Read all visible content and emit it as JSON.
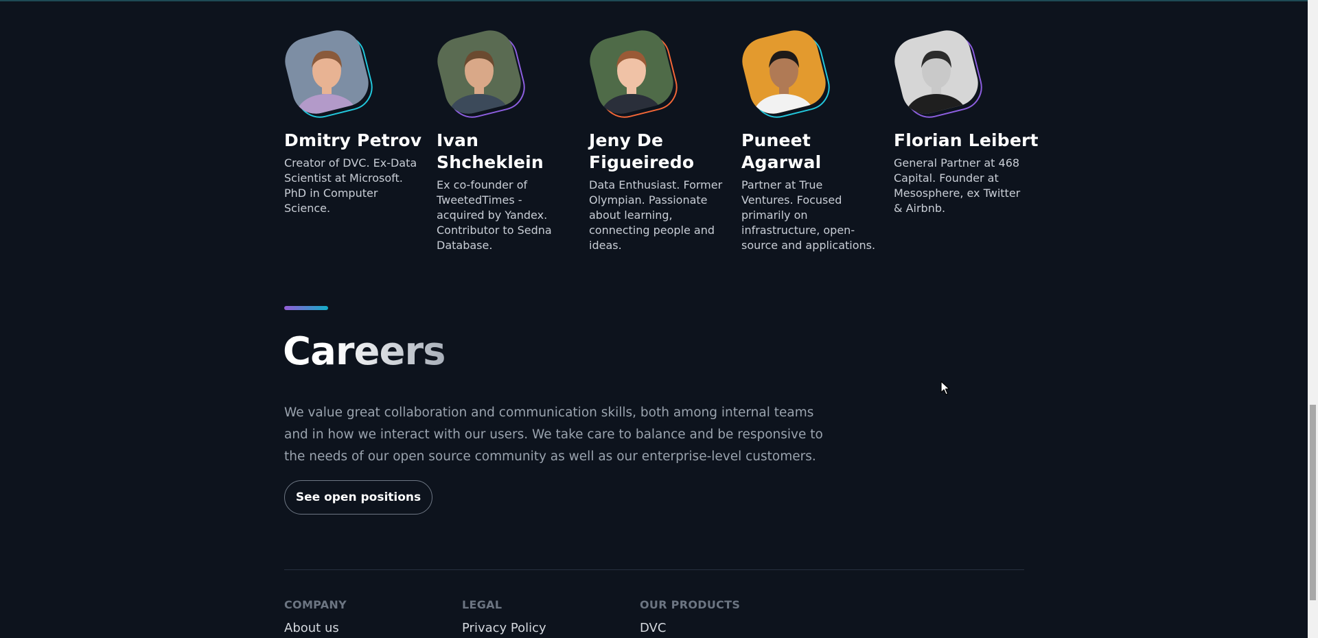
{
  "team": [
    {
      "name": "Dmitry Petrov",
      "bio": "Creator of DVC. Ex-Data Scientist at Microsoft. PhD in Computer Science.",
      "ring_color": "#22c7dc",
      "photo_bg": "#7d8ea4",
      "skin": "#e8b393",
      "hair": "#8a5a3b",
      "shirt": "#b39ac9"
    },
    {
      "name": "Ivan Shcheklein",
      "bio": "Ex co-founder of TweetedTimes - acquired by Yandex. Contributor to Sedna Database.",
      "ring_color": "#8d5fe0",
      "photo_bg": "#5a6b52",
      "skin": "#d9a888",
      "hair": "#6b4a30",
      "shirt": "#3c4a5a"
    },
    {
      "name": "Jeny De Figueiredo",
      "bio": "Data Enthusiast. Former Olympian. Passionate about learning, connecting people and ideas.",
      "ring_color": "#f46737",
      "photo_bg": "#4f6b48",
      "skin": "#f0c2a6",
      "hair": "#9a5a36",
      "shirt": "#2a2f3a"
    },
    {
      "name": "Puneet Agarwal",
      "bio": "Partner at True Ventures. Focused primarily on infrastructure, open-source and applications.",
      "ring_color": "#22c7dc",
      "photo_bg": "#e39a2e",
      "skin": "#b07a55",
      "hair": "#1e1a18",
      "shirt": "#f2f2f2"
    },
    {
      "name": "Florian Leibert",
      "bio": "General Partner at 468 Capital. Founder at Mesosphere, ex Twitter & Airbnb.",
      "ring_color": "#8d5fe0",
      "photo_bg": "#d6d6d6",
      "skin": "#c9c9c9",
      "hair": "#2b2b2b",
      "shirt": "#1f1f1f"
    }
  ],
  "careers": {
    "title": "Careers",
    "text": "We value great collaboration and communication skills, both among internal teams and in how we interact with our users. We take care to balance and be responsive to the needs of our open source community as well as our enterprise-level customers.",
    "button_label": "See open positions"
  },
  "footer": {
    "columns": [
      {
        "heading": "COMPANY",
        "link": "About us"
      },
      {
        "heading": "LEGAL",
        "link": "Privacy Policy"
      },
      {
        "heading": "OUR PRODUCTS",
        "link": "DVC"
      }
    ]
  },
  "colors": {
    "background": "#0d131d",
    "accent_start": "#945dd6",
    "accent_end": "#13adc7"
  }
}
